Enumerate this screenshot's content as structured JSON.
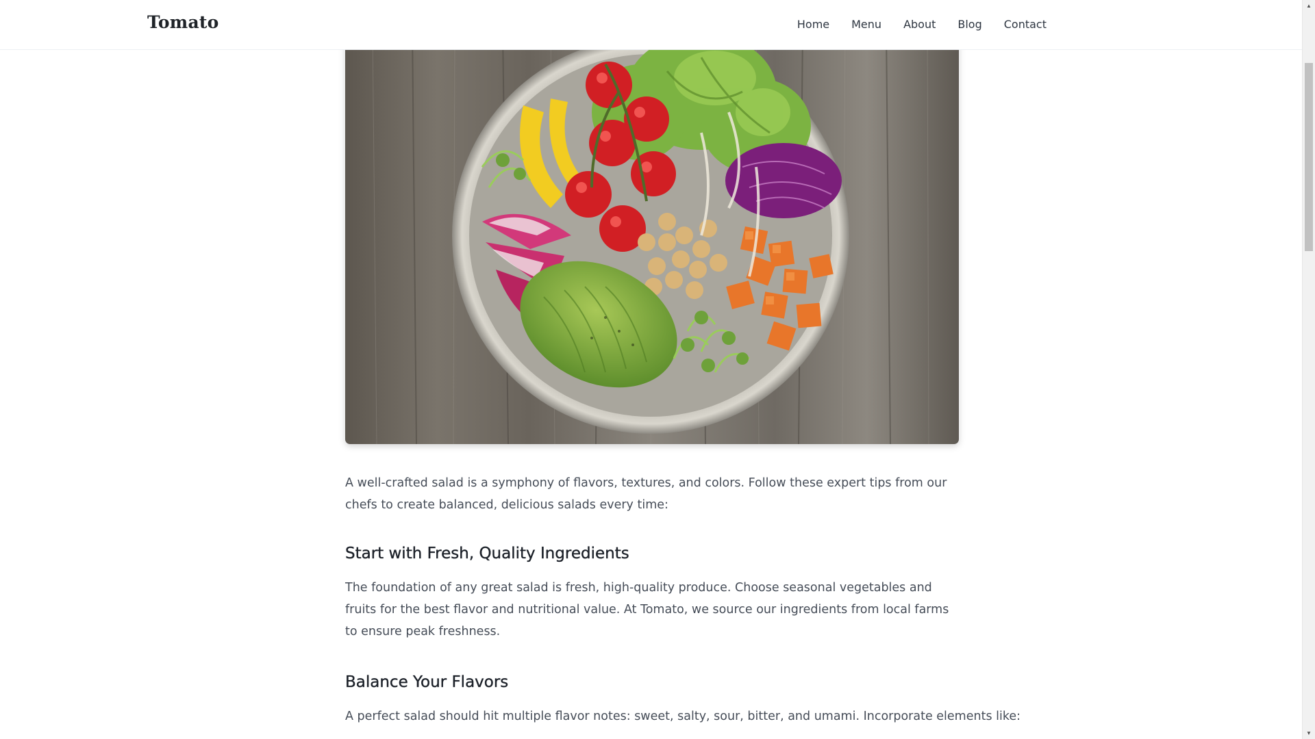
{
  "header": {
    "brand": "Tomato",
    "nav": [
      {
        "label": "Home"
      },
      {
        "label": "Menu"
      },
      {
        "label": "About"
      },
      {
        "label": "Blog"
      },
      {
        "label": "Contact"
      }
    ]
  },
  "hero": {
    "subject": "salad-bowl-photo"
  },
  "article": {
    "intro": "A well-crafted salad is a symphony of flavors, textures, and colors. Follow these expert tips from our chefs to create balanced, delicious salads every time:",
    "sections": [
      {
        "heading": "Start with Fresh, Quality Ingredients",
        "body": "The foundation of any great salad is fresh, high-quality produce. Choose seasonal vegetables and fruits for the best flavor and nutritional value. At Tomato, we source our ingredients from local farms to ensure peak freshness."
      },
      {
        "heading": "Balance Your Flavors",
        "body": "A perfect salad should hit multiple flavor notes: sweet, salty, sour, bitter, and umami. Incorporate elements like:"
      }
    ]
  },
  "colors": {
    "text": "#454c57",
    "heading": "#1c2129",
    "brand": "#1f2328"
  }
}
